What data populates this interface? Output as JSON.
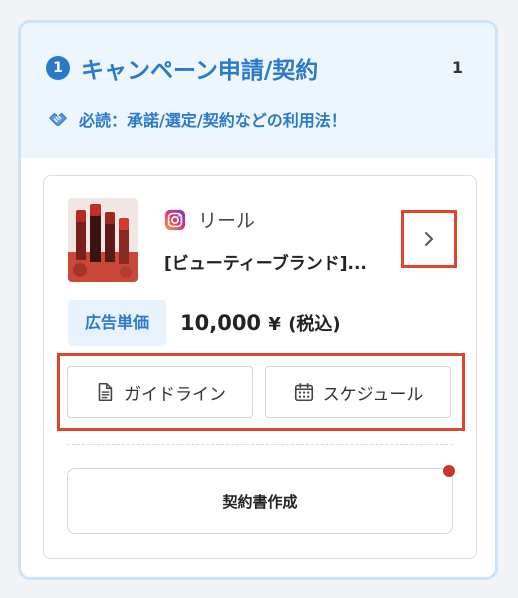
{
  "header": {
    "step_number": "1",
    "title": "キャンペーン申請/契約",
    "count": "1",
    "guide_text": "必読：承諾/選定/契約などの利用法！"
  },
  "campaign": {
    "platform_icon": "instagram-icon",
    "platform_label": "リール",
    "title": "[ビューティーブランド]...",
    "price_label": "広告単価",
    "price_amount": "10,000",
    "price_currency": "¥",
    "price_tax": "(税込)"
  },
  "buttons": {
    "guideline": "ガイドライン",
    "schedule": "スケジュール",
    "contract": "契約書作成"
  },
  "colors": {
    "accent": "#2b7ac9",
    "highlight": "#e0442a",
    "notify": "#c8372d"
  }
}
